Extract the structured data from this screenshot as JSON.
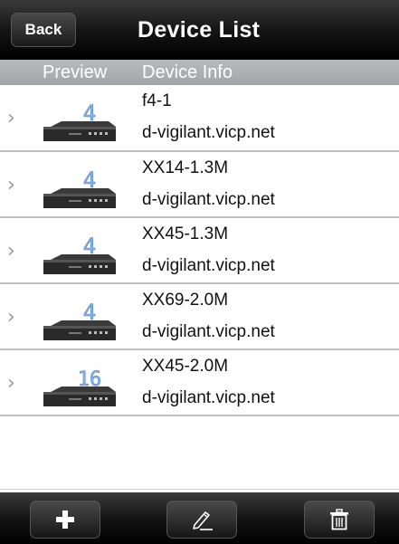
{
  "navbar": {
    "back_label": "Back",
    "title": "Device List"
  },
  "columns": {
    "preview": "Preview",
    "info": "Device Info"
  },
  "devices": [
    {
      "name": "f4-1",
      "host": "d-vigilant.vicp.net",
      "channels": "4"
    },
    {
      "name": "XX14-1.3M",
      "host": "d-vigilant.vicp.net",
      "channels": "4"
    },
    {
      "name": "XX45-1.3M",
      "host": "d-vigilant.vicp.net",
      "channels": "4"
    },
    {
      "name": "XX69-2.0M",
      "host": "d-vigilant.vicp.net",
      "channels": "4"
    },
    {
      "name": "XX45-2.0M",
      "host": "d-vigilant.vicp.net",
      "channels": "16"
    }
  ],
  "toolbar": {
    "add_icon": "plus-icon",
    "edit_icon": "pencil-icon",
    "delete_icon": "trash-icon"
  },
  "colors": {
    "channel_digit": "#8fb8e8",
    "header_bg": "#aeb0b3"
  }
}
